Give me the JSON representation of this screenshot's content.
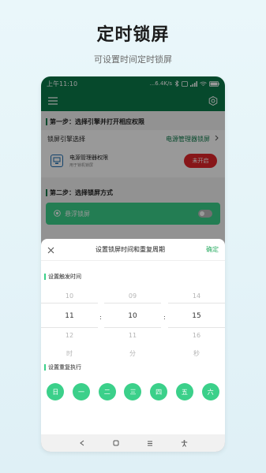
{
  "promo": {
    "title": "定时锁屏",
    "subtitle": "可设置时间定时锁屏"
  },
  "status": {
    "time": "上午11:10",
    "speed": "...6.4K/s",
    "battery": "100"
  },
  "app": {
    "accent": "#0b7a4a",
    "step1": "第一步：选择引擎并打开相应权限",
    "engine_label": "锁屏引擎选择",
    "engine_value": "电源管理器锁屏",
    "perm_title": "电源管理器权限",
    "perm_desc": "用于锁机锁屏",
    "perm_button": "未开启",
    "step2": "第二步：选择锁屏方式",
    "float_label": "悬浮锁屏"
  },
  "sheet": {
    "title": "设置锁屏时间和重复周期",
    "confirm": "确定",
    "trigger_section": "设置触发时间",
    "repeat_section": "设置重复执行",
    "hours": [
      "10",
      "11",
      "12"
    ],
    "minutes": [
      "09",
      "10",
      "11"
    ],
    "seconds": [
      "14",
      "15",
      "16"
    ],
    "units": [
      "时",
      "分",
      "秒"
    ],
    "separator": ":",
    "days": [
      "日",
      "一",
      "二",
      "三",
      "四",
      "五",
      "六"
    ]
  }
}
